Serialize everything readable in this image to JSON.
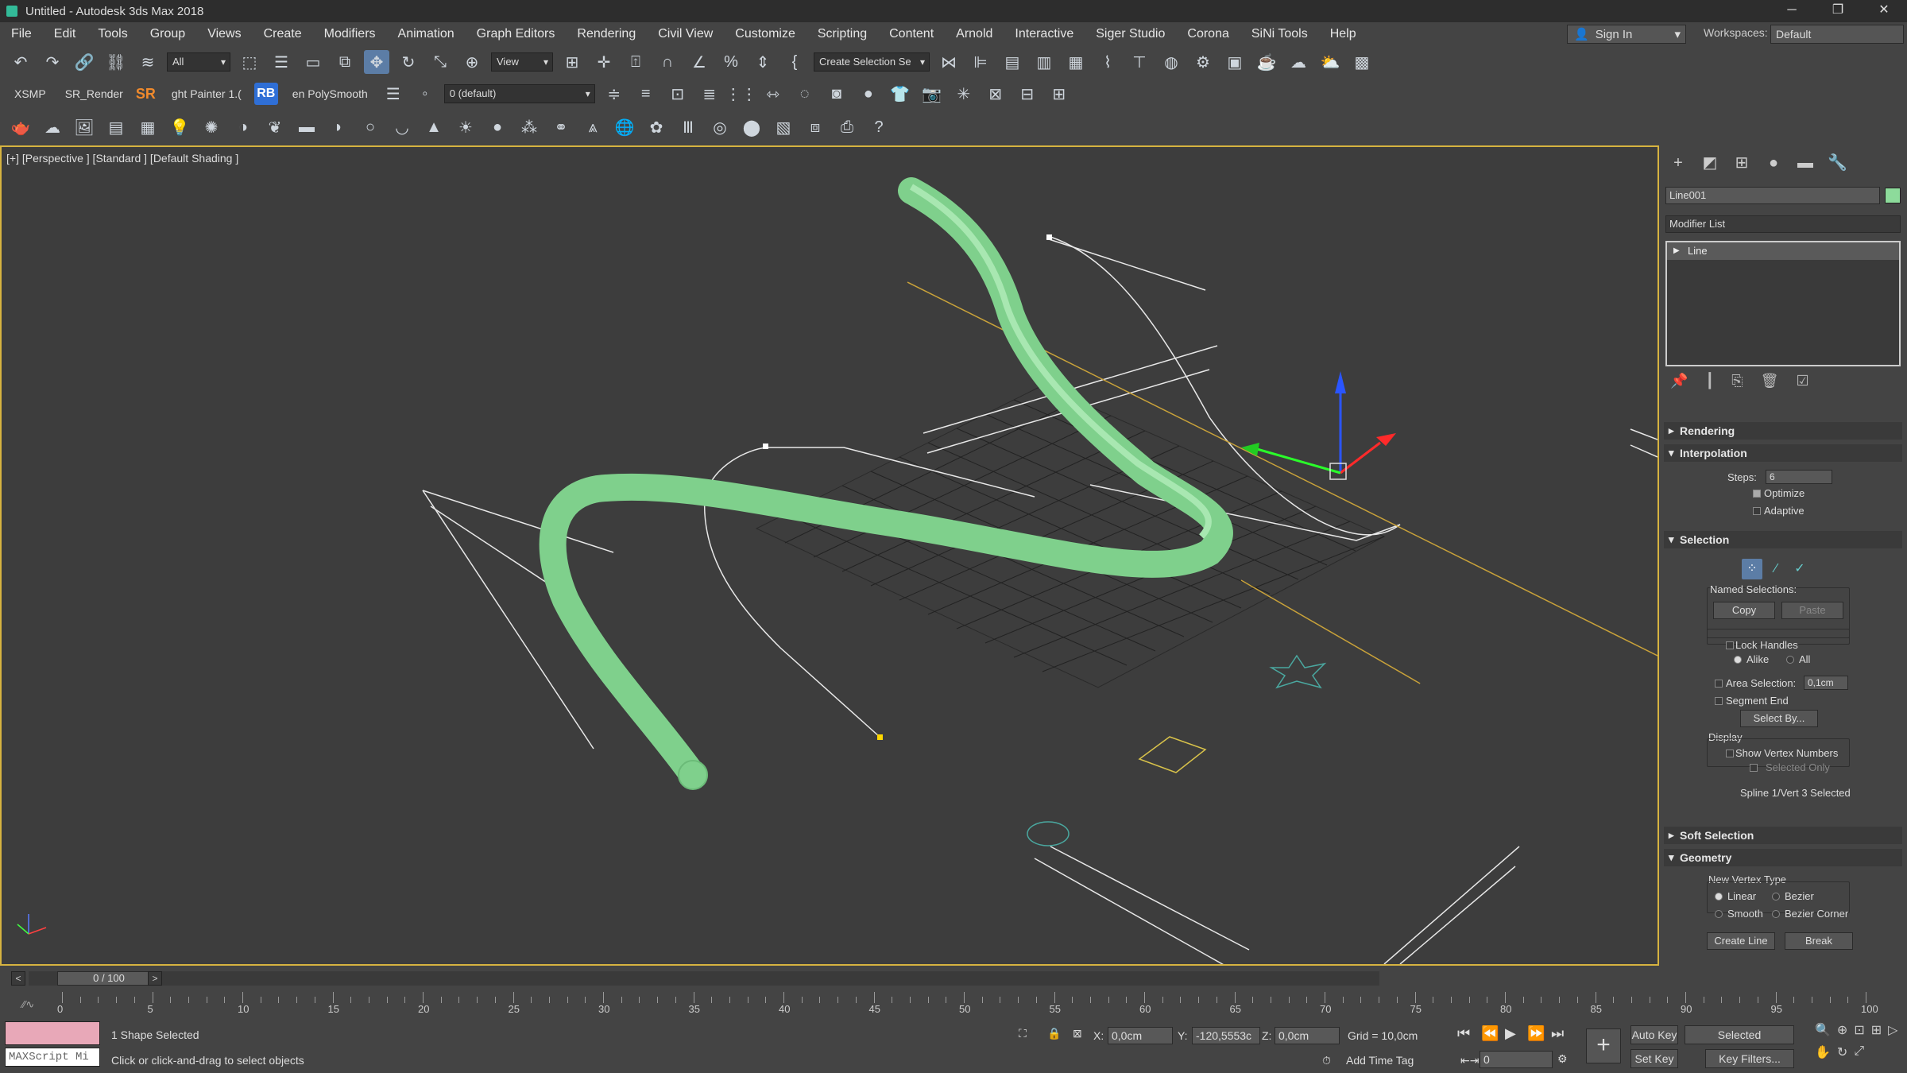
{
  "window": {
    "title": "Untitled - Autodesk 3ds Max 2018",
    "minimize": "─",
    "restore": "❐",
    "close": "✕"
  },
  "menu": [
    "File",
    "Edit",
    "Tools",
    "Group",
    "Views",
    "Create",
    "Modifiers",
    "Animation",
    "Graph Editors",
    "Rendering",
    "Civil View",
    "Customize",
    "Scripting",
    "Content",
    "Arnold",
    "Interactive",
    "Siger Studio",
    "Corona",
    "SiNi Tools",
    "Help"
  ],
  "account": {
    "sign_in": "Sign In",
    "workspaces_label": "Workspaces:",
    "workspace": "Default"
  },
  "toolbar1": {
    "selection_filter": "All",
    "ref_coord": "View",
    "create_selection_set": "Create Selection Se"
  },
  "toolbar2": {
    "xsmp": "XSMP",
    "sr_render": "SR_Render",
    "sr": "SR",
    "light_painter": "ght Painter 1.(",
    "rb": "RB",
    "polysmooth": "en PolySmooth",
    "layer": "0 (default)"
  },
  "viewport": {
    "label": "[+] [Perspective ] [Standard ] [Default Shading ]"
  },
  "command_panel": {
    "object_name": "Line001",
    "object_color": "#8ddb9b",
    "modifier_list": "Modifier List",
    "stack_item": "Line",
    "rollouts": {
      "rendering": "Rendering",
      "interpolation": "Interpolation",
      "selection": "Selection",
      "soft_selection": "Soft Selection",
      "geometry": "Geometry"
    },
    "interpolation": {
      "steps_label": "Steps:",
      "steps_value": "6",
      "optimize": "Optimize",
      "adaptive": "Adaptive"
    },
    "selection": {
      "named_selections": "Named Selections:",
      "copy": "Copy",
      "paste": "Paste",
      "lock_handles": "Lock Handles",
      "alike": "Alike",
      "all": "All",
      "area_selection": "Area Selection:",
      "area_value": "0,1cm",
      "segment_end": "Segment End",
      "select_by": "Select By...",
      "display": "Display",
      "show_vertex_numbers": "Show Vertex Numbers",
      "selected_only": "Selected Only",
      "status": "Spline 1/Vert 3 Selected"
    },
    "geometry": {
      "new_vertex_type": "New Vertex Type",
      "linear": "Linear",
      "bezier": "Bezier",
      "smooth": "Smooth",
      "bezier_corner": "Bezier Corner",
      "create_line": "Create Line",
      "break": "Break"
    }
  },
  "timeline": {
    "frame": "0 / 100",
    "ticks": [
      "0",
      "5",
      "10",
      "15",
      "20",
      "25",
      "30",
      "35",
      "40",
      "45",
      "50",
      "55",
      "60",
      "65",
      "70",
      "75",
      "80",
      "85",
      "90",
      "95",
      "100"
    ]
  },
  "status": {
    "maxscript": "MAXScript Mi",
    "selected": "1 Shape Selected",
    "prompt": "Click or click-and-drag to select objects",
    "x_label": "X:",
    "x": "0,0cm",
    "y_label": "Y:",
    "y": "-120,5553c",
    "z_label": "Z:",
    "z": "0,0cm",
    "grid": "Grid = 10,0cm",
    "add_time_tag": "Add Time Tag",
    "auto_key": "Auto Key",
    "set_key": "Set Key",
    "key_mode": "Selected",
    "key_filters": "Key Filters...",
    "frame_field": "0"
  }
}
